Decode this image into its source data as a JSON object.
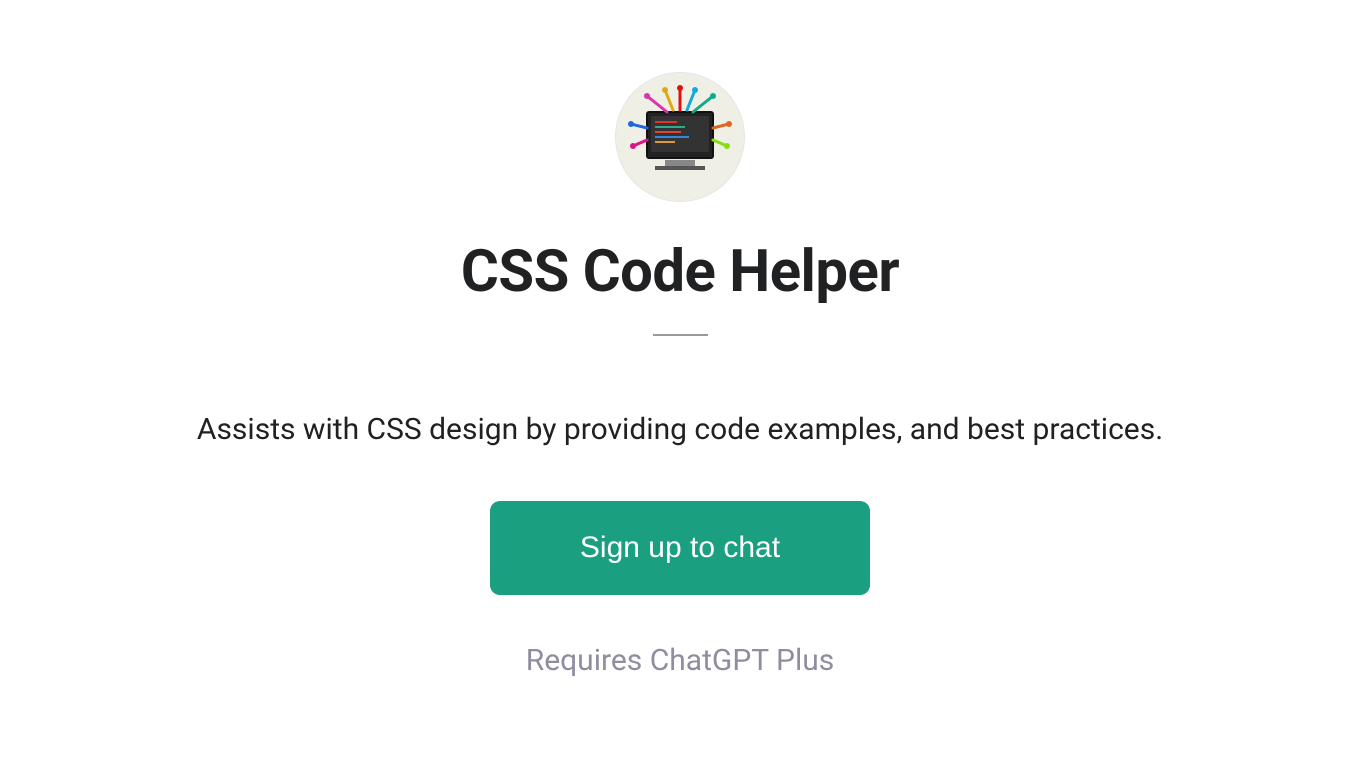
{
  "avatar": {
    "iconName": "monitor-code-burst-icon"
  },
  "title": "CSS Code Helper",
  "description": "Assists with CSS design by providing code examples, and best practices.",
  "signupButton": "Sign up to chat",
  "requirement": "Requires ChatGPT Plus"
}
